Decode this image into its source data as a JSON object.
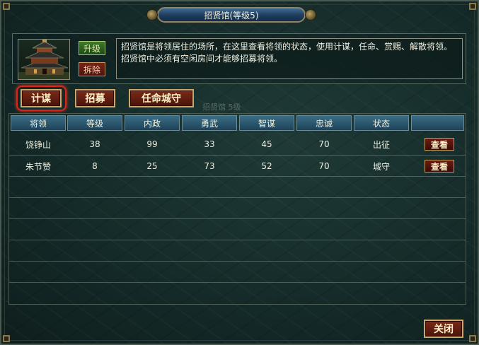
{
  "window": {
    "title": "招贤馆(等级5)"
  },
  "info": {
    "description": "招贤馆是将领居住的场所，在这里查看将领的状态，使用计谋，任命、赏赐、解散将领。招贤馆中必须有空闲房间才能够招募将领。",
    "upgrade_label": "升级",
    "demolish_label": "拆除",
    "portrait_icon": "pagoda-building-icon"
  },
  "actions": {
    "strategy_label": "计谋",
    "recruit_label": "招募",
    "appoint_label": "任命城守",
    "ghost_label": "招贤馆 5级"
  },
  "table": {
    "headers": [
      "将领",
      "等级",
      "内政",
      "勇武",
      "智谋",
      "忠诚",
      "状态",
      ""
    ],
    "rows": [
      {
        "name": "饶铮山",
        "level": "38",
        "politics": "99",
        "valor": "33",
        "wisdom": "45",
        "loyalty": "70",
        "status": "出征",
        "action": "查看"
      },
      {
        "name": "朱节赞",
        "level": "8",
        "politics": "25",
        "valor": "73",
        "wisdom": "52",
        "loyalty": "70",
        "status": "城守",
        "action": "查看"
      }
    ]
  },
  "footer": {
    "close_label": "关闭"
  },
  "colors": {
    "accent_gold": "#caa668",
    "button_red": "#7a2a18",
    "header_blue": "#3a6e86",
    "highlight_red": "#d8241c"
  }
}
